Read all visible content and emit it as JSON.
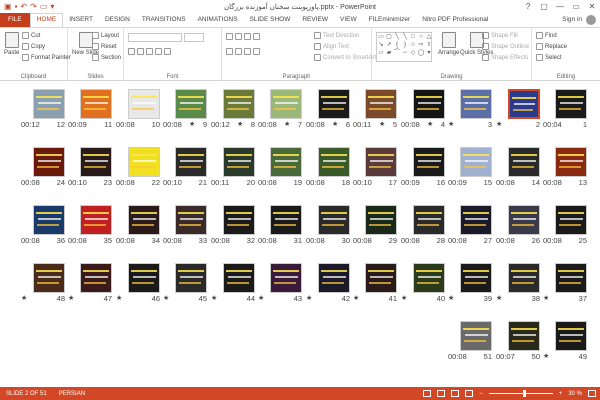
{
  "window": {
    "title": "پاورپوینت سخنان آموزنده بزرگان.pptx - PowerPoint",
    "controls": [
      "?",
      "▢",
      "—",
      "▭",
      "✕"
    ]
  },
  "qat": {
    "icons": [
      "save-icon",
      "undo-icon",
      "redo-icon",
      "present-icon",
      "customize-icon"
    ]
  },
  "tabs": [
    {
      "label": "FILE",
      "key": "file"
    },
    {
      "label": "HOME",
      "key": "home"
    },
    {
      "label": "INSERT",
      "key": "insert"
    },
    {
      "label": "DESIGN",
      "key": "design"
    },
    {
      "label": "TRANSITIONS",
      "key": "transitions"
    },
    {
      "label": "ANIMATIONS",
      "key": "animations"
    },
    {
      "label": "SLIDE SHOW",
      "key": "slideshow"
    },
    {
      "label": "REVIEW",
      "key": "review"
    },
    {
      "label": "VIEW",
      "key": "view"
    },
    {
      "label": "FILEminimizer",
      "key": "fileminimizer"
    },
    {
      "label": "Nitro PDF Professional",
      "key": "nitro"
    }
  ],
  "active_tab": "home",
  "signin": "Sign in",
  "ribbon": {
    "clipboard": {
      "label": "Clipboard",
      "paste": "Paste",
      "cut": "Cut",
      "copy": "Copy",
      "format_painter": "Format Painter"
    },
    "slides": {
      "label": "Slides",
      "new_slide": "New Slide",
      "layout": "Layout",
      "reset": "Reset",
      "section": "Section"
    },
    "font": {
      "label": "Font"
    },
    "paragraph": {
      "label": "Paragraph",
      "text_direction": "Text Direction",
      "align_text": "Align Text",
      "convert_smartart": "Convert to SmartArt"
    },
    "drawing": {
      "label": "Drawing",
      "arrange": "Arrange",
      "quick_styles": "Quick Styles",
      "shape_fill": "Shape Fill",
      "shape_outline": "Shape Outline",
      "shape_effects": "Shape Effects"
    },
    "editing": {
      "label": "Editing",
      "find": "Find",
      "replace": "Replace",
      "select": "Select"
    }
  },
  "slides": [
    {
      "num": "1",
      "time": "00:04",
      "star": false,
      "bg": "#1a1a1a",
      "row": 0,
      "col": 0
    },
    {
      "num": "2",
      "time": "",
      "star": true,
      "bg": "#2b3a8a",
      "row": 0,
      "col": 1,
      "selected": true
    },
    {
      "num": "3",
      "time": "",
      "star": true,
      "bg": "#5a6fa8",
      "row": 0,
      "col": 2
    },
    {
      "num": "4",
      "time": "00:08",
      "star": true,
      "bg": "#151515",
      "row": 0,
      "col": 3
    },
    {
      "num": "5",
      "time": "00:11",
      "star": true,
      "bg": "#7a4a2a",
      "row": 0,
      "col": 4
    },
    {
      "num": "6",
      "time": "00:08",
      "star": true,
      "bg": "#1a1a1a",
      "row": 0,
      "col": 5
    },
    {
      "num": "7",
      "time": "00:08",
      "star": true,
      "bg": "#9ab87a",
      "row": 0,
      "col": 6
    },
    {
      "num": "8",
      "time": "00:12",
      "star": true,
      "bg": "#6a7a3a",
      "row": 0,
      "col": 7
    },
    {
      "num": "9",
      "time": "00:08",
      "star": true,
      "bg": "#5a8a4a",
      "row": 0,
      "col": 8
    },
    {
      "num": "10",
      "time": "00:08",
      "star": false,
      "bg": "#e8e8e8",
      "row": 0,
      "col": 9
    },
    {
      "num": "11",
      "time": "00:09",
      "star": false,
      "bg": "#e07020",
      "row": 0,
      "col": 10
    },
    {
      "num": "12",
      "time": "00:12",
      "star": false,
      "bg": "#8aa0b0",
      "row": 0,
      "col": 11
    },
    {
      "num": "13",
      "time": "00:08",
      "star": false,
      "bg": "#8a2a10",
      "row": 1,
      "col": 0
    },
    {
      "num": "14",
      "time": "00:08",
      "star": false,
      "bg": "#2a2a2a",
      "row": 1,
      "col": 1
    },
    {
      "num": "15",
      "time": "00:09",
      "star": false,
      "bg": "#a0b0d0",
      "row": 1,
      "col": 2
    },
    {
      "num": "16",
      "time": "00:09",
      "star": false,
      "bg": "#1a1a1a",
      "row": 1,
      "col": 3
    },
    {
      "num": "17",
      "time": "00:10",
      "star": false,
      "bg": "#5a3a3a",
      "row": 1,
      "col": 4
    },
    {
      "num": "18",
      "time": "00:08",
      "star": false,
      "bg": "#3a5a2a",
      "row": 1,
      "col": 5
    },
    {
      "num": "19",
      "time": "00:08",
      "star": false,
      "bg": "#4a6a3a",
      "row": 1,
      "col": 6
    },
    {
      "num": "20",
      "time": "00:11",
      "star": false,
      "bg": "#2a3a2a",
      "row": 1,
      "col": 7
    },
    {
      "num": "21",
      "time": "00:10",
      "star": false,
      "bg": "#2a2a2a",
      "row": 1,
      "col": 8
    },
    {
      "num": "22",
      "time": "00:08",
      "star": false,
      "bg": "#f0e020",
      "row": 1,
      "col": 9
    },
    {
      "num": "23",
      "time": "00:10",
      "star": false,
      "bg": "#2a1a1a",
      "row": 1,
      "col": 10
    },
    {
      "num": "24",
      "time": "00:08",
      "star": false,
      "bg": "#6a1a0a",
      "row": 1,
      "col": 11
    },
    {
      "num": "25",
      "time": "00:08",
      "star": false,
      "bg": "#1a1a1a",
      "row": 2,
      "col": 0
    },
    {
      "num": "26",
      "time": "00:08",
      "star": false,
      "bg": "#3a3a4a",
      "row": 2,
      "col": 1
    },
    {
      "num": "27",
      "time": "00:08",
      "star": false,
      "bg": "#1a1a2a",
      "row": 2,
      "col": 2
    },
    {
      "num": "28",
      "time": "00:08",
      "star": false,
      "bg": "#2a2a2a",
      "row": 2,
      "col": 3
    },
    {
      "num": "29",
      "time": "00:08",
      "star": false,
      "bg": "#1a2a1a",
      "row": 2,
      "col": 4
    },
    {
      "num": "30",
      "time": "00:08",
      "star": false,
      "bg": "#2a2a2a",
      "row": 2,
      "col": 5
    },
    {
      "num": "31",
      "time": "00:08",
      "star": false,
      "bg": "#1a1a1a",
      "row": 2,
      "col": 6
    },
    {
      "num": "32",
      "time": "00:08",
      "star": false,
      "bg": "#1a1a1a",
      "row": 2,
      "col": 7
    },
    {
      "num": "33",
      "time": "00:08",
      "star": false,
      "bg": "#3a2a2a",
      "row": 2,
      "col": 8
    },
    {
      "num": "34",
      "time": "00:08",
      "star": false,
      "bg": "#2a1a1a",
      "row": 2,
      "col": 9
    },
    {
      "num": "35",
      "time": "00:08",
      "star": false,
      "bg": "#c02020",
      "row": 2,
      "col": 10
    },
    {
      "num": "36",
      "time": "00:08",
      "star": false,
      "bg": "#1a3a6a",
      "row": 2,
      "col": 11
    },
    {
      "num": "37",
      "time": "",
      "star": true,
      "bg": "#1a1a1a",
      "row": 3,
      "col": 0
    },
    {
      "num": "38",
      "time": "",
      "star": true,
      "bg": "#2a2a2a",
      "row": 3,
      "col": 1
    },
    {
      "num": "39",
      "time": "",
      "star": true,
      "bg": "#1a1a1a",
      "row": 3,
      "col": 2
    },
    {
      "num": "40",
      "time": "",
      "star": true,
      "bg": "#2a3a1a",
      "row": 3,
      "col": 3
    },
    {
      "num": "41",
      "time": "",
      "star": true,
      "bg": "#2a1a1a",
      "row": 3,
      "col": 4
    },
    {
      "num": "42",
      "time": "",
      "star": true,
      "bg": "#1a1a2a",
      "row": 3,
      "col": 5
    },
    {
      "num": "43",
      "time": "",
      "star": true,
      "bg": "#3a1a3a",
      "row": 3,
      "col": 6
    },
    {
      "num": "44",
      "time": "",
      "star": true,
      "bg": "#1a1a1a",
      "row": 3,
      "col": 7
    },
    {
      "num": "45",
      "time": "",
      "star": true,
      "bg": "#2a2a2a",
      "row": 3,
      "col": 8
    },
    {
      "num": "46",
      "time": "",
      "star": true,
      "bg": "#1a1a1a",
      "row": 3,
      "col": 9
    },
    {
      "num": "47",
      "time": "",
      "star": true,
      "bg": "#3a1a1a",
      "row": 3,
      "col": 10
    },
    {
      "num": "48",
      "time": "",
      "star": true,
      "bg": "#4a2a1a",
      "row": 3,
      "col": 11
    },
    {
      "num": "49",
      "time": "",
      "star": true,
      "bg": "#1a1a1a",
      "row": 4,
      "col": 0
    },
    {
      "num": "50",
      "time": "00:07",
      "star": false,
      "bg": "#2a2a1a",
      "row": 4,
      "col": 1
    },
    {
      "num": "51",
      "time": "00:08",
      "star": false,
      "bg": "#6a6a6a",
      "row": 4,
      "col": 2
    }
  ],
  "status": {
    "slide_info": "SLIDE 2 OF 51",
    "language": "PERSIAN",
    "zoom": "30 %",
    "zoom_fraction": 0.3
  },
  "colors": {
    "accent": "#d24726",
    "file_tab": "#c43e1c"
  }
}
